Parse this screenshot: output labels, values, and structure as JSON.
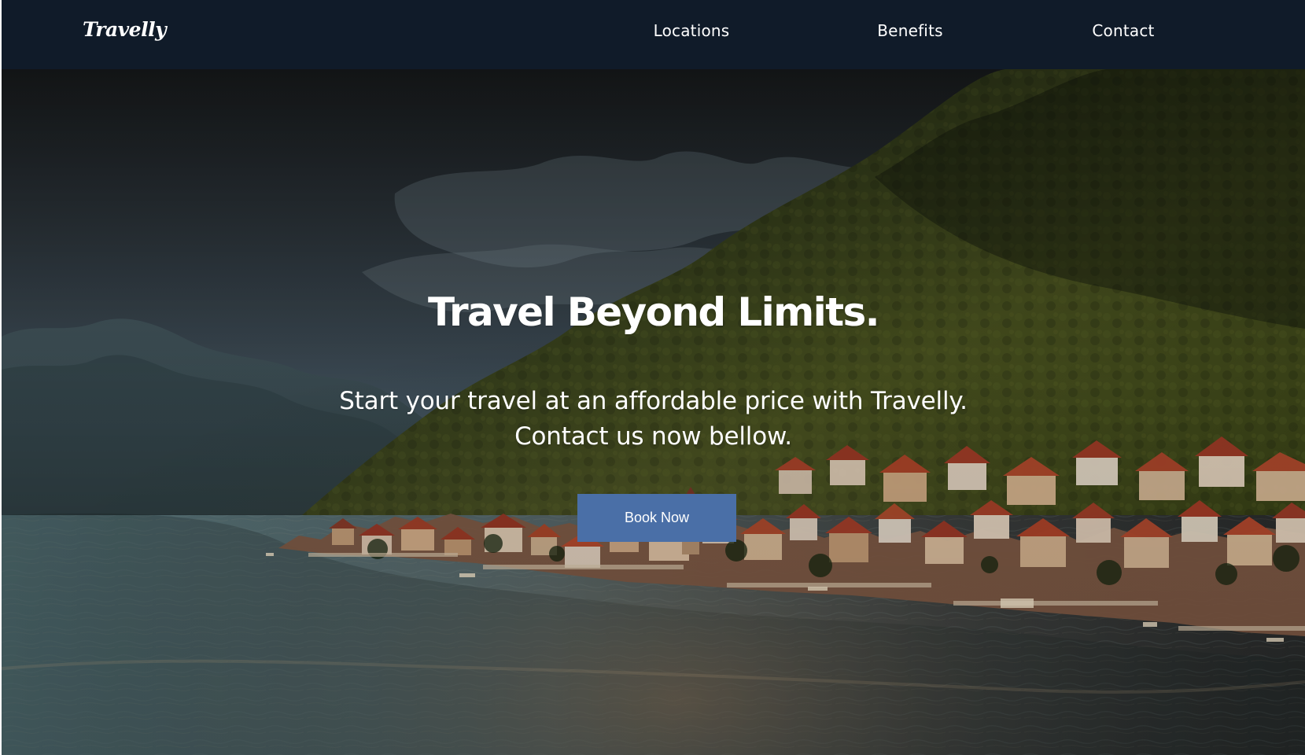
{
  "header": {
    "logo": "Travelly",
    "nav": [
      {
        "label": "Locations"
      },
      {
        "label": "Benefits"
      },
      {
        "label": "Contact"
      }
    ]
  },
  "hero": {
    "image": "coastal-mountain-town-photo",
    "title": "Travel Beyond Limits.",
    "description": [
      "Start your travel at an affordable price with Travelly.",
      "Contact us now bellow."
    ],
    "button_label": "Book Now"
  },
  "colors": {
    "nav_background": "#101b29",
    "button": "#4a6fa7",
    "text": "#ffffff"
  }
}
